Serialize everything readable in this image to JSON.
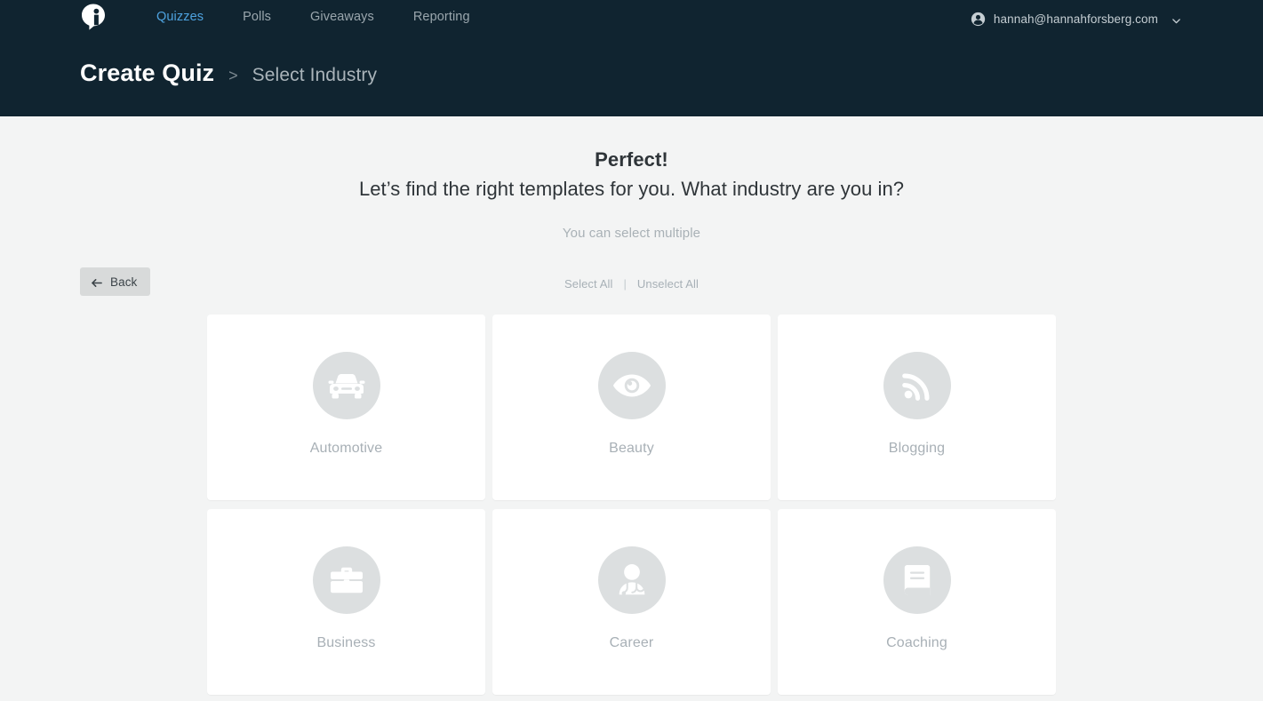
{
  "header": {
    "logo_icon": "interact-logo-icon",
    "nav": [
      {
        "label": "Quizzes",
        "active": true
      },
      {
        "label": "Polls",
        "active": false
      },
      {
        "label": "Giveaways",
        "active": false
      },
      {
        "label": "Reporting",
        "active": false
      }
    ],
    "user": {
      "icon": "account-circle-icon",
      "email": "hannah@hannahforsberg.com",
      "chevron_icon": "chevron-down-icon"
    },
    "breadcrumb": {
      "root": "Create Quiz",
      "separator": ">",
      "current": "Select Industry"
    },
    "background_color": "#102430",
    "active_link_color": "#4ea3e0"
  },
  "main": {
    "back_button": {
      "label": "Back",
      "icon": "arrow-left-icon"
    },
    "headline": "Perfect!",
    "subheadline": "Let’s find the right templates for you. What industry are you in?",
    "hint": "You can select multiple",
    "select_all_label": "Select All",
    "divider": "|",
    "unselect_all_label": "Unselect All",
    "cards": [
      {
        "label": "Automotive",
        "icon": "car-icon",
        "selected": false
      },
      {
        "label": "Beauty",
        "icon": "eye-icon",
        "selected": false
      },
      {
        "label": "Blogging",
        "icon": "rss-feed-icon",
        "selected": false
      },
      {
        "label": "Business",
        "icon": "briefcase-icon",
        "selected": false
      },
      {
        "label": "Career",
        "icon": "doctor-stethoscope-icon",
        "selected": false
      },
      {
        "label": "Coaching",
        "icon": "book-icon",
        "selected": false
      }
    ],
    "page_background": "#f3f4f4",
    "card_background": "#ffffff",
    "icon_circle_color": "#dcdfe0",
    "card_label_color": "#a8b0b6"
  }
}
